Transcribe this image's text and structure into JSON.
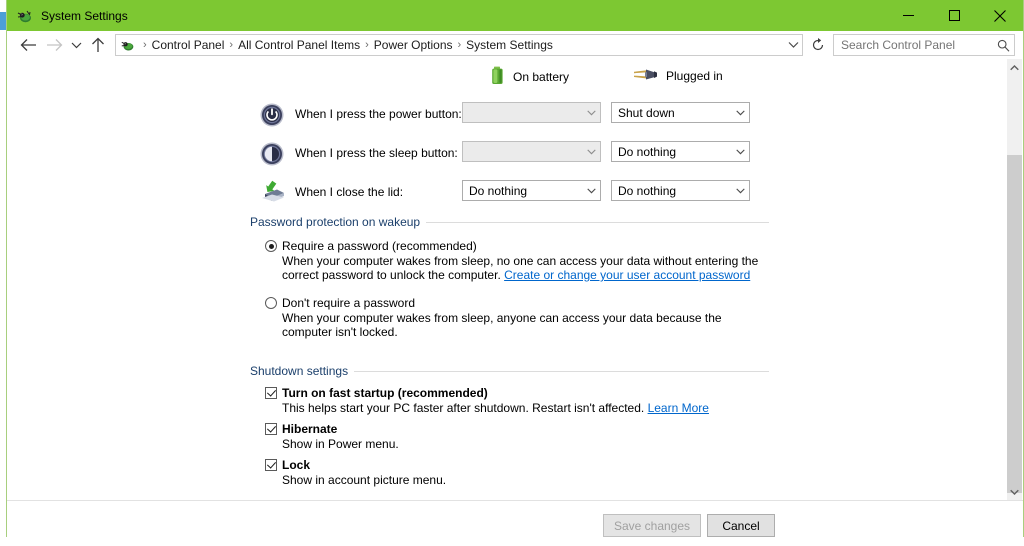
{
  "window": {
    "title": "System Settings",
    "title_icon": "system-settings-icon",
    "accent_color": "#7dc832",
    "border_color": "#a8cf7e"
  },
  "caption": {
    "minimize_label": "Minimize",
    "maximize_label": "Maximize",
    "close_label": "Close"
  },
  "navbar": {
    "back_label": "Back",
    "forward_label": "Forward",
    "recent_label": "Recent locations",
    "up_label": "Up one level",
    "refresh_label": "Refresh",
    "breadcrumb": [
      "Control Panel",
      "All Control Panel Items",
      "Power Options",
      "System Settings"
    ],
    "separator": "›",
    "search": {
      "placeholder": "Search Control Panel",
      "value": ""
    }
  },
  "content": {
    "power_sources": [
      {
        "icon": "battery-icon",
        "label": "On battery"
      },
      {
        "icon": "power-plug-icon",
        "label": "Plugged in"
      }
    ],
    "rows": [
      {
        "icon": "power-button-icon",
        "label": "When I press the power button:",
        "on_battery": {
          "value": "",
          "disabled": true
        },
        "plugged_in": {
          "value": "Shut down",
          "disabled": false
        }
      },
      {
        "icon": "sleep-button-icon",
        "label": "When I press the sleep button:",
        "on_battery": {
          "value": "",
          "disabled": true
        },
        "plugged_in": {
          "value": "Do nothing",
          "disabled": false
        }
      },
      {
        "icon": "laptop-lid-icon",
        "label": "When I close the lid:",
        "on_battery": {
          "value": "Do nothing",
          "disabled": false
        },
        "plugged_in": {
          "value": "Do nothing",
          "disabled": false
        }
      }
    ],
    "password_section": {
      "title": "Password protection on wakeup",
      "options": [
        {
          "label": "Require a password (recommended)",
          "selected": true,
          "desc_before": "When your computer wakes from sleep, no one can access your data without entering the correct password to unlock the computer. ",
          "link": "Create or change your user account password",
          "desc_after": ""
        },
        {
          "label": "Don't require a password",
          "selected": false,
          "desc_before": "When your computer wakes from sleep, anyone can access your data because the computer isn't locked.",
          "link": "",
          "desc_after": ""
        }
      ]
    },
    "shutdown_section": {
      "title": "Shutdown settings",
      "items": [
        {
          "label": "Turn on fast startup (recommended)",
          "checked": true,
          "desc_before": "This helps start your PC faster after shutdown. Restart isn't affected. ",
          "link": "Learn More",
          "desc_after": ""
        },
        {
          "label": "Hibernate",
          "checked": true,
          "desc_before": "Show in Power menu.",
          "link": "",
          "desc_after": ""
        },
        {
          "label": "Lock",
          "checked": true,
          "desc_before": "Show in account picture menu.",
          "link": "",
          "desc_after": ""
        }
      ]
    }
  },
  "scrollbar": {
    "up_label": "Scroll up",
    "down_label": "Scroll down"
  },
  "footer": {
    "save_label": "Save changes",
    "save_disabled": true,
    "cancel_label": "Cancel"
  }
}
